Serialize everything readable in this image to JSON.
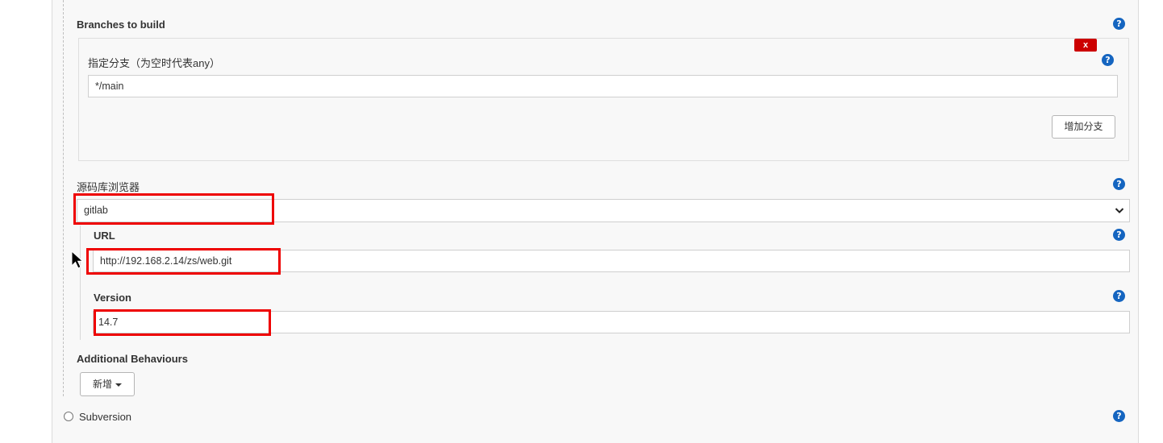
{
  "branches": {
    "title": "Branches to build",
    "spec_label": "指定分支（为空时代表any）",
    "spec_value": "*/main",
    "delete_label": "x",
    "add_branch_label": "增加分支"
  },
  "browser": {
    "label": "源码库浏览器",
    "selected": "gitlab"
  },
  "url": {
    "label": "URL",
    "value": "http://192.168.2.14/zs/web.git"
  },
  "version": {
    "label": "Version",
    "value": "14.7"
  },
  "additional": {
    "label": "Additional Behaviours",
    "add_label": "新增"
  },
  "scm_option": {
    "label": "Subversion"
  },
  "help_glyph": "?",
  "colors": {
    "help": "#1565c0",
    "highlight": "#ee0000",
    "delete": "#cc0000"
  }
}
